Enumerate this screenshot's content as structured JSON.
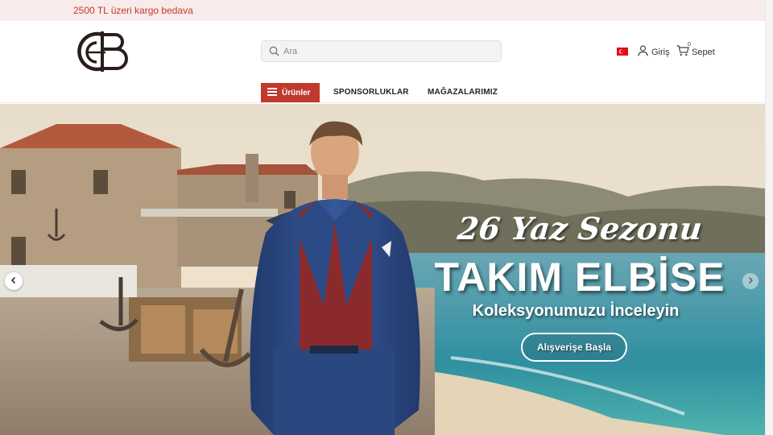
{
  "promo": {
    "text": "2500 TL üzeri kargo bedava"
  },
  "header": {
    "search_placeholder": "Ara",
    "login_label": "Giriş",
    "cart_label": "Sepet",
    "cart_count": "0",
    "flag_icon": "turkey-flag-icon"
  },
  "nav": {
    "products_label": "Ürünler",
    "links": [
      "SPONSORLUKLAR",
      "MAĞAZALARIMIZ"
    ]
  },
  "hero": {
    "season": "26 Yaz Sezonu",
    "title": "TAKIM ELBİSE",
    "subtitle": "Koleksyonumuzu İnceleyin",
    "cta": "Alışverişe Başla"
  },
  "colors": {
    "accent": "#c0392b",
    "promo_bg": "#f8ebeb",
    "suit": "#2e4a82",
    "shirt": "#8a2a2c"
  }
}
